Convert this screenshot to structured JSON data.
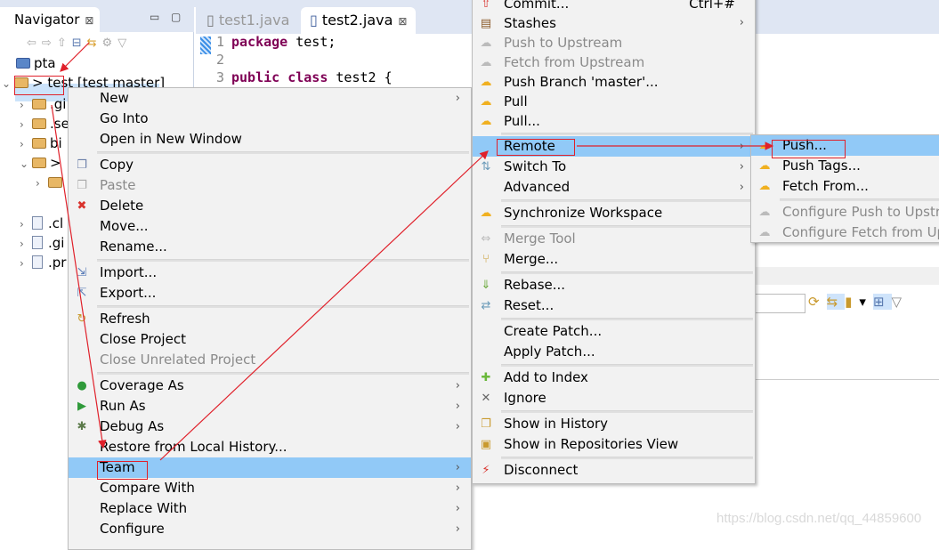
{
  "navigator": {
    "title": "Navigator",
    "close": "⊠",
    "minimize": "▭",
    "maximize": "▢",
    "tree": [
      {
        "label": "pta",
        "indent": 0
      },
      {
        "label": "> test [test master]",
        "indent": 0,
        "expanded": true
      },
      {
        "label": ".gi",
        "indent": 1
      },
      {
        "label": ".se",
        "indent": 1
      },
      {
        "label": "bi",
        "indent": 1
      },
      {
        "label": "> ",
        "indent": 1,
        "expanded": true
      },
      {
        "label": "",
        "indent": 2
      },
      {
        "label": ".cl",
        "indent": 1,
        "file": true
      },
      {
        "label": ".gi",
        "indent": 1,
        "file": true
      },
      {
        "label": ".pr",
        "indent": 1,
        "file": true
      }
    ]
  },
  "editor": {
    "tabs": [
      {
        "label": "test1.java",
        "active": false
      },
      {
        "label": "test2.java",
        "active": true,
        "close": "⊠"
      }
    ],
    "lines": [
      {
        "n": "1",
        "kw": "package",
        "rest": " test;"
      },
      {
        "n": "2",
        "kw": "",
        "rest": ""
      },
      {
        "n": "3",
        "kw": "public class",
        "rest": " test2 {"
      }
    ]
  },
  "context_menu": {
    "items": [
      {
        "label": "New",
        "sub": true
      },
      {
        "label": "Go Into"
      },
      {
        "label": "Open in New Window"
      },
      {
        "sep": true
      },
      {
        "label": "Copy",
        "icon": "copy-icon",
        "glyph": "❐",
        "color": "#6a7ea8"
      },
      {
        "label": "Paste",
        "icon": "paste-icon",
        "glyph": "❐",
        "color": "#aaa",
        "disabled": true
      },
      {
        "label": "Delete",
        "icon": "delete-icon",
        "glyph": "✖",
        "color": "#d9322c"
      },
      {
        "label": "Move..."
      },
      {
        "label": "Rename..."
      },
      {
        "sep": true
      },
      {
        "label": "Import...",
        "icon": "import-icon",
        "glyph": "⇲",
        "color": "#5b7db8"
      },
      {
        "label": "Export...",
        "icon": "export-icon",
        "glyph": "⇱",
        "color": "#5b7db8"
      },
      {
        "sep": true
      },
      {
        "label": "Refresh",
        "icon": "refresh-icon",
        "glyph": "↻",
        "color": "#c99a2e"
      },
      {
        "label": "Close Project"
      },
      {
        "label": "Close Unrelated Project",
        "disabled": true
      },
      {
        "sep": true
      },
      {
        "label": "Coverage As",
        "icon": "coverage-icon",
        "glyph": "●",
        "color": "#2f9a3a",
        "sub": true
      },
      {
        "label": "Run As",
        "icon": "run-icon",
        "glyph": "▶",
        "color": "#2f9a3a",
        "sub": true
      },
      {
        "label": "Debug As",
        "icon": "debug-icon",
        "glyph": "✱",
        "color": "#5b7a4a",
        "sub": true
      },
      {
        "label": "Restore from Local History..."
      },
      {
        "label": "Team",
        "sub": true,
        "highlighted": true
      },
      {
        "label": "Compare With",
        "sub": true
      },
      {
        "label": "Replace With",
        "sub": true
      },
      {
        "label": "Configure",
        "sub": true
      }
    ]
  },
  "team_menu": {
    "items": [
      {
        "label": "Commit...",
        "shortcut": "Ctrl+#",
        "icon": "commit-icon",
        "glyph": "⇧",
        "color": "#d9322c"
      },
      {
        "label": "Stashes",
        "sub": true,
        "icon": "stashes-icon",
        "glyph": "▤",
        "color": "#8a5a2a"
      },
      {
        "label": "Push to Upstream",
        "disabled": true,
        "icon": "push-upstream-icon",
        "glyph": "☁",
        "color": "#bbb"
      },
      {
        "label": "Fetch from Upstream",
        "disabled": true,
        "icon": "fetch-upstream-icon",
        "glyph": "☁",
        "color": "#bbb"
      },
      {
        "label": "Push Branch 'master'...",
        "icon": "push-branch-icon",
        "glyph": "☁",
        "color": "#f0b020"
      },
      {
        "label": "Pull",
        "icon": "pull-icon",
        "glyph": "☁",
        "color": "#f0b020"
      },
      {
        "label": "Pull...",
        "icon": "pull-dialog-icon",
        "glyph": "☁",
        "color": "#f0b020"
      },
      {
        "sep": true
      },
      {
        "label": "Remote",
        "sub": true,
        "highlighted": true
      },
      {
        "label": "Switch To",
        "sub": true,
        "icon": "switch-icon",
        "glyph": "⇅",
        "color": "#6a9ab8"
      },
      {
        "label": "Advanced",
        "sub": true
      },
      {
        "sep": true
      },
      {
        "label": "Synchronize Workspace",
        "icon": "sync-icon",
        "glyph": "☁",
        "color": "#f0b020"
      },
      {
        "sep": true
      },
      {
        "label": "Merge Tool",
        "disabled": true,
        "icon": "merge-tool-icon",
        "glyph": "⇔",
        "color": "#bbb"
      },
      {
        "label": "Merge...",
        "icon": "merge-icon",
        "glyph": "⑂",
        "color": "#c99a2e"
      },
      {
        "sep": true
      },
      {
        "label": "Rebase...",
        "icon": "rebase-icon",
        "glyph": "⇓",
        "color": "#6aa83a"
      },
      {
        "label": "Reset...",
        "icon": "reset-icon",
        "glyph": "⇄",
        "color": "#6a9ab8"
      },
      {
        "sep": true
      },
      {
        "label": "Create Patch..."
      },
      {
        "label": "Apply Patch..."
      },
      {
        "sep": true
      },
      {
        "label": "Add to Index",
        "icon": "add-index-icon",
        "glyph": "✚",
        "color": "#6ab83a"
      },
      {
        "label": "Ignore",
        "icon": "ignore-icon",
        "glyph": "✕",
        "color": "#666"
      },
      {
        "sep": true
      },
      {
        "label": "Show in History",
        "icon": "history-icon",
        "glyph": "❐",
        "color": "#c99a2e"
      },
      {
        "label": "Show in Repositories View",
        "icon": "repositories-icon",
        "glyph": "▣",
        "color": "#c99a2e"
      },
      {
        "sep": true
      },
      {
        "label": "Disconnect",
        "icon": "disconnect-icon",
        "glyph": "⚡",
        "color": "#d9322c"
      }
    ]
  },
  "remote_menu": {
    "items": [
      {
        "label": "Push...",
        "highlighted": true,
        "icon": "push-icon",
        "glyph": "☁",
        "color": "#f0b020"
      },
      {
        "label": "Push Tags...",
        "icon": "push-tags-icon",
        "glyph": "☁",
        "color": "#f0b020"
      },
      {
        "label": "Fetch From...",
        "icon": "fetch-icon",
        "glyph": "☁",
        "color": "#f0b020"
      },
      {
        "sep": true
      },
      {
        "label": "Configure Push to Upstre",
        "disabled": true,
        "icon": "configure-push-icon",
        "glyph": "☁",
        "color": "#bbb"
      },
      {
        "label": "Configure Fetch from Up",
        "disabled": true,
        "icon": "configure-fetch-icon",
        "glyph": "☁",
        "color": "#bbb"
      }
    ]
  },
  "watermark": "https://blog.csdn.net/qq_44859600",
  "colors": {
    "highlight": "#91c9f7",
    "annotation": "#e0202a",
    "selection": "#cce3fa"
  }
}
